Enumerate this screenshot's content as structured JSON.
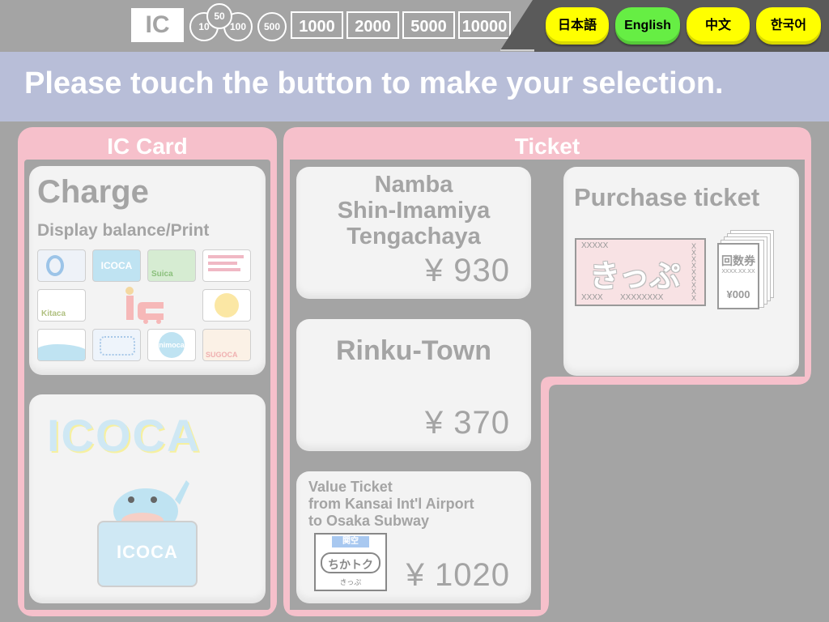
{
  "money": {
    "ic_label": "IC",
    "coins": [
      "10",
      "50",
      "100",
      "500"
    ],
    "notes": [
      "1000",
      "2000",
      "5000",
      "10000"
    ]
  },
  "languages": [
    {
      "label": "日本語",
      "active": false
    },
    {
      "label": "English",
      "active": true
    },
    {
      "label": "中文",
      "active": false
    },
    {
      "label": "한국어",
      "active": false
    }
  ],
  "banner": "Please touch the button to make your selection.",
  "ic_card": {
    "title": "IC Card",
    "charge": {
      "title": "Charge",
      "subtitle": "Display balance/Print",
      "card_labels": [
        "ICOCA",
        "Suica",
        "Kitaca",
        "nimoca",
        "SUGOCA"
      ]
    },
    "icoca_logo": "ICOCA",
    "icoca_card_label": "ICOCA"
  },
  "ticket": {
    "title": "Ticket",
    "namba": {
      "dest1": "Namba",
      "dest2": "Shin-Imamiya",
      "dest3": "Tengachaya",
      "price": "¥ 930"
    },
    "rinku": {
      "dest": "Rinku-Town",
      "price": "¥ 370"
    },
    "value": {
      "line1": "Value Ticket",
      "line2": "from Kansai Int'l Airport",
      "line3": "to Osaka Subway",
      "icon_text1": "関空",
      "icon_text2": "ちかトク",
      "icon_text3": "きっぷ",
      "price": "¥ 1020"
    },
    "purchase": {
      "title": "Purchase ticket",
      "kippu": "きっぷ",
      "kippu_top": "XXXXX",
      "kippu_bottom1": "XXXX",
      "kippu_bottom2": "XXXXXXXX",
      "kippu_side": "XXXXXXXXX",
      "coupon_title": "回数券",
      "coupon_code": "XXXX.XX.XX",
      "coupon_price": "¥000"
    }
  },
  "colors": {
    "accent_pink": "#f6c0cb",
    "lang_yellow": "#ffff00",
    "lang_active": "#66ee44",
    "banner": "#b8bed8"
  }
}
